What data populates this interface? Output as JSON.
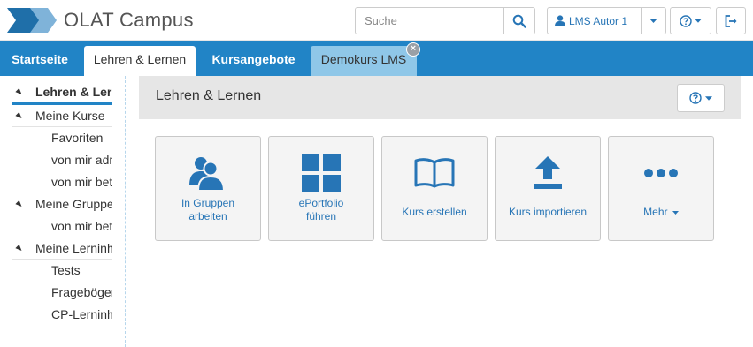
{
  "header": {
    "brand": "OLAT Campus",
    "search_placeholder": "Suche",
    "user_label": "LMS Autor 1",
    "icons": {
      "search": "search-icon",
      "user": "user-icon",
      "help": "help-icon",
      "logout": "logout-icon"
    }
  },
  "nav": {
    "tabs": [
      {
        "label": "Startseite",
        "active": false
      },
      {
        "label": "Lehren & Lernen",
        "active": true
      },
      {
        "label": "Kursangebote",
        "active": false
      },
      {
        "label": "Demokurs LMS",
        "active": false,
        "closable": true
      }
    ]
  },
  "sidebar": {
    "items": [
      {
        "label": "Lehren & Lernen",
        "level": 0,
        "selected": true
      },
      {
        "label": "Meine Kurse",
        "level": 0
      },
      {
        "label": "Favoriten",
        "level": 1
      },
      {
        "label": "von mir administriert",
        "level": 1
      },
      {
        "label": "von mir betreut",
        "level": 1
      },
      {
        "label": "Meine Gruppen",
        "level": 0
      },
      {
        "label": "von mir betreut",
        "level": 1
      },
      {
        "label": "Meine Lerninhalte",
        "level": 0
      },
      {
        "label": "Tests",
        "level": 1
      },
      {
        "label": "Fragebögen",
        "level": 1
      },
      {
        "label": "CP-Lerninhalte",
        "level": 1
      }
    ]
  },
  "main": {
    "title": "Lehren & Lernen",
    "tiles": [
      {
        "line1": "In Gruppen",
        "line2": "arbeiten",
        "icon": "users-icon"
      },
      {
        "line1": "ePortfolio",
        "line2": "führen",
        "icon": "grid-icon"
      },
      {
        "line1": "Kurs erstellen",
        "line2": "",
        "icon": "book-icon"
      },
      {
        "line1": "Kurs importieren",
        "line2": "",
        "icon": "upload-icon"
      },
      {
        "line1": "Mehr",
        "line2": "",
        "icon": "more-icon"
      }
    ]
  },
  "colors": {
    "brand_blue": "#2184c6",
    "link_blue": "#2775b6",
    "tab_course": "#8fc7e8"
  }
}
